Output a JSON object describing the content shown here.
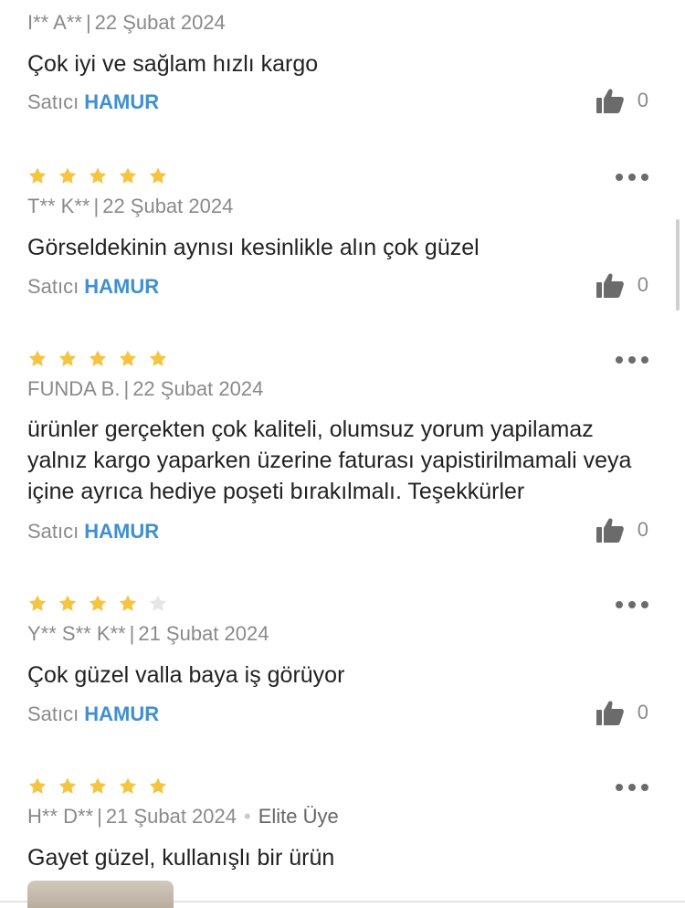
{
  "reviews": [
    {
      "author": "I** A**",
      "date": "22 Şubat 2024",
      "comment": "Çok iyi ve sağlam hızlı kargo",
      "seller_label": "Satıcı",
      "seller_name": "HAMUR",
      "likes": "0"
    },
    {
      "rating": 5,
      "author": "T** K**",
      "date": "22 Şubat 2024",
      "comment": "Görseldekinin aynısı kesinlikle alın çok güzel",
      "seller_label": "Satıcı",
      "seller_name": "HAMUR",
      "likes": "0"
    },
    {
      "rating": 5,
      "author": "FUNDA B.",
      "date": "22 Şubat 2024",
      "comment": "ürünler gerçekten çok kaliteli, olumsuz yorum yapilamaz yalnız kargo yaparken üzerine faturası yapistirilmamali veya içine ayrıca hediye poşeti bırakılmalı. Teşekkürler",
      "seller_label": "Satıcı",
      "seller_name": "HAMUR",
      "likes": "0"
    },
    {
      "rating": 4,
      "author": "Y** S** K**",
      "date": "21 Şubat 2024",
      "comment": "Çok güzel valla baya iş görüyor",
      "seller_label": "Satıcı",
      "seller_name": "HAMUR",
      "likes": "0"
    },
    {
      "rating": 5,
      "author": "H** D**",
      "date": "21 Şubat 2024",
      "badge": "Elite Üye",
      "comment": "Gayet güzel, kullanışlı bir ürün"
    }
  ],
  "separator": "|",
  "colors": {
    "star_filled": "#f5c542",
    "star_empty": "#e6e6e6",
    "seller_link": "#3f8fd2"
  },
  "icons": {
    "like": "thumbs-up-icon",
    "more": "more-options-icon",
    "star": "star-icon"
  }
}
